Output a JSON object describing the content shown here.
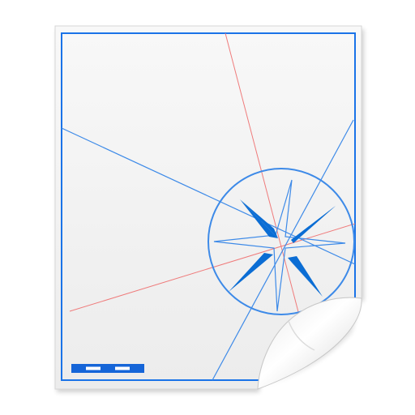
{
  "icon": {
    "name": "map-document-icon",
    "colors": {
      "background": "#ffffff",
      "paper_top": "#f8f8f8",
      "paper_bottom": "#ececec",
      "border_blue": "#1a73e8",
      "line_blue": "#3d8ae8",
      "line_red": "#ef7b7b",
      "rose_blue": "#0b6dd4",
      "scale_bar": "#1565d8",
      "curl_light": "#ffffff",
      "curl_shade": "#cfcfcf"
    },
    "parts": [
      "paper-sheet",
      "map-frame",
      "meridian-lines",
      "compass-rose",
      "scale-bar",
      "page-curl"
    ]
  }
}
